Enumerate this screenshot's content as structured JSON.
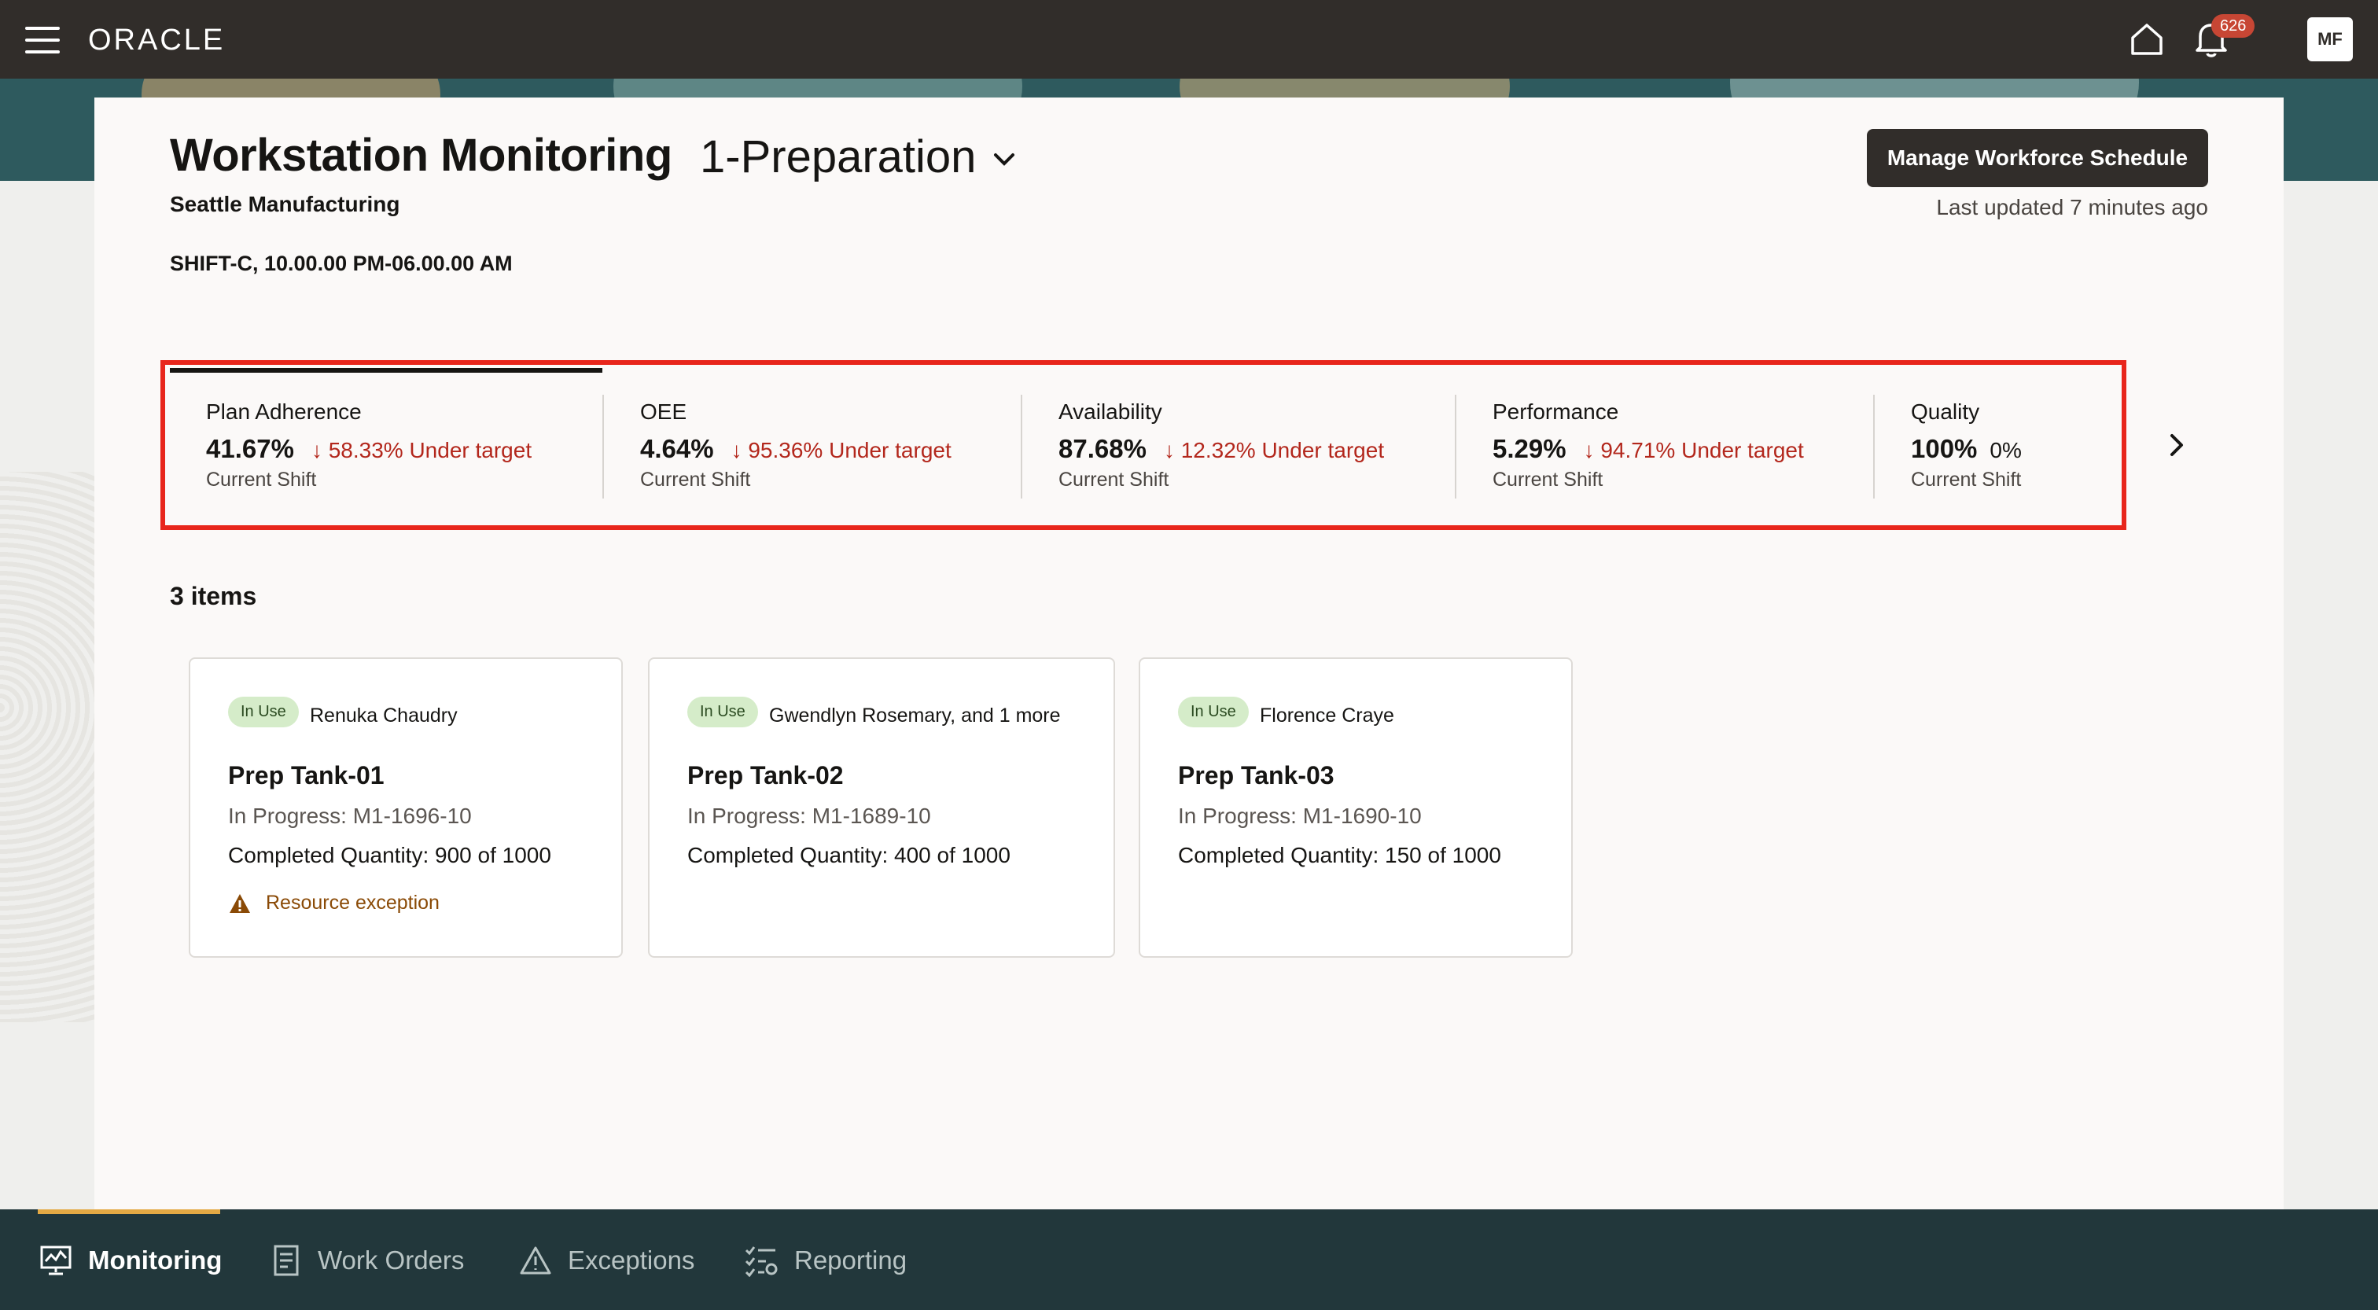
{
  "header": {
    "brand": "ORACLE",
    "notification_count": "626",
    "avatar_initials": "MF"
  },
  "page": {
    "title": "Workstation Monitoring",
    "selected_stage": "1-Preparation",
    "organization": "Seattle Manufacturing",
    "shift": "SHIFT-C, 10.00.00 PM-06.00.00 AM",
    "manage_button": "Manage Workforce Schedule",
    "last_updated": "Last updated 7 minutes ago"
  },
  "kpis": [
    {
      "label": "Plan Adherence",
      "value": "41.67%",
      "delta": "↓ 58.33% Under target",
      "sub": "Current Shift"
    },
    {
      "label": "OEE",
      "value": "4.64%",
      "delta": "↓ 95.36% Under target",
      "sub": "Current Shift"
    },
    {
      "label": "Availability",
      "value": "87.68%",
      "delta": "↓ 12.32% Under target",
      "sub": "Current Shift"
    },
    {
      "label": "Performance",
      "value": "5.29%",
      "delta": "↓ 94.71% Under target",
      "sub": "Current Shift"
    },
    {
      "label": "Quality",
      "value": "100%",
      "delta": "0%",
      "sub": "Current Shift"
    }
  ],
  "items_count": "3 items",
  "cards": [
    {
      "badge": "In Use",
      "person": "Renuka Chaudry",
      "title": "Prep Tank-01",
      "status": "In Progress: M1-1696-10",
      "quantity": "Completed Quantity: 900 of 1000",
      "exception": "Resource exception"
    },
    {
      "badge": "In Use",
      "person": "Gwendlyn Rosemary, and 1 more",
      "title": "Prep Tank-02",
      "status": "In Progress: M1-1689-10",
      "quantity": "Completed Quantity: 400 of 1000"
    },
    {
      "badge": "In Use",
      "person": "Florence Craye",
      "title": "Prep Tank-03",
      "status": "In Progress: M1-1690-10",
      "quantity": "Completed Quantity: 150 of 1000"
    }
  ],
  "bottom_nav": [
    {
      "label": "Monitoring",
      "icon": "monitor-chart-icon"
    },
    {
      "label": "Work Orders",
      "icon": "document-icon"
    },
    {
      "label": "Exceptions",
      "icon": "warning-icon"
    },
    {
      "label": "Reporting",
      "icon": "checklist-settings-icon"
    }
  ],
  "colors": {
    "header_bg": "#312d2a",
    "bottom_nav_bg": "#22373b",
    "under_target": "#b3271c",
    "highlight_border": "#e8261c",
    "in_use_badge": "#d5ecc9",
    "active_tab_accent": "#e4a944"
  }
}
